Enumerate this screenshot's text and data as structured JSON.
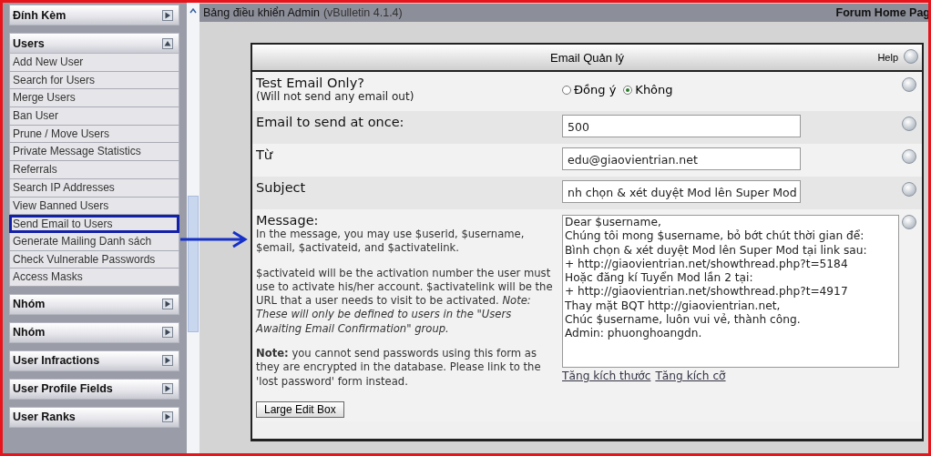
{
  "sidebar": {
    "groups": [
      {
        "title": "Đính Kèm",
        "expanded": false
      },
      {
        "title": "Users",
        "expanded": true,
        "items": [
          {
            "label": "Add New User",
            "selected": false
          },
          {
            "label": "Search for Users",
            "selected": false
          },
          {
            "label": "Merge Users",
            "selected": false
          },
          {
            "label": "Ban User",
            "selected": false
          },
          {
            "label": "Prune / Move Users",
            "selected": false
          },
          {
            "label": "Private Message Statistics",
            "selected": false
          },
          {
            "label": "Referrals",
            "selected": false
          },
          {
            "label": "Search IP Addresses",
            "selected": false
          },
          {
            "label": "View Banned Users",
            "selected": false
          },
          {
            "label": "Send Email to Users",
            "selected": true
          },
          {
            "label": "Generate Mailing Danh sách",
            "selected": false
          },
          {
            "label": "Check Vulnerable Passwords",
            "selected": false
          },
          {
            "label": "Access Masks",
            "selected": false
          }
        ]
      },
      {
        "title": "Nhóm",
        "expanded": false
      },
      {
        "title": "Nhóm",
        "expanded": false
      },
      {
        "title": "User Infractions",
        "expanded": false
      },
      {
        "title": "User Profile Fields",
        "expanded": false
      },
      {
        "title": "User Ranks",
        "expanded": false
      }
    ]
  },
  "header": {
    "title": "Bảng điều khiển Admin",
    "version": "(vBulletin 4.1.4)",
    "link": "Forum Home Pag"
  },
  "form": {
    "title": "Email Quản lý",
    "help": "Help",
    "rows": [
      {
        "kind": "radio",
        "label": "Test Email Only?",
        "note": "(Will not send any email out)",
        "options": [
          {
            "label": "Đồng ý",
            "selected": false
          },
          {
            "label": "Không",
            "selected": true
          }
        ]
      },
      {
        "kind": "input",
        "label": "Email to send at once:",
        "value": "500"
      },
      {
        "kind": "input",
        "label": "Từ",
        "value": "edu@giaovientrian.net"
      },
      {
        "kind": "input",
        "label": "Subject",
        "value": "nh chọn & xét duyệt Mod lên Super Mod"
      },
      {
        "kind": "textarea",
        "label": "Message:",
        "paragraphs": [
          "In the message, you may use $userid, $username, $email, $activateid, and $activatelink.",
          "$activateid will be the activation number the user must use to activate his/her account. $activatelink will be the URL that a user needs to visit to be activated. *Note: These will only be defined to users in the \"Users Awaiting Email Confirmation\" group.*",
          "**Note:** you cannot send passwords using this form as they are encrypted in the database. Please link to the 'lost password' form instead."
        ],
        "button": "Large Edit Box",
        "value": "Dear $username,\nChúng tôi mong $username, bỏ bớt chút thời gian để:\nBình chọn & xét duyệt Mod lên Super Mod tại link sau:\n+ http://giaovientrian.net/showthread.php?t=5184\nHoặc đăng kí Tuyển Mod lần 2 tại:\n+ http://giaovientrian.net/showthread.php?t=4917\nThay mặt BQT http://giaovientrian.net,\nChúc $username, luôn vui vẻ, thành công.\nAdmin: phuonghoangdn.",
        "links": [
          "Tăng kích thước",
          "Tăng kích cỡ"
        ]
      }
    ]
  }
}
